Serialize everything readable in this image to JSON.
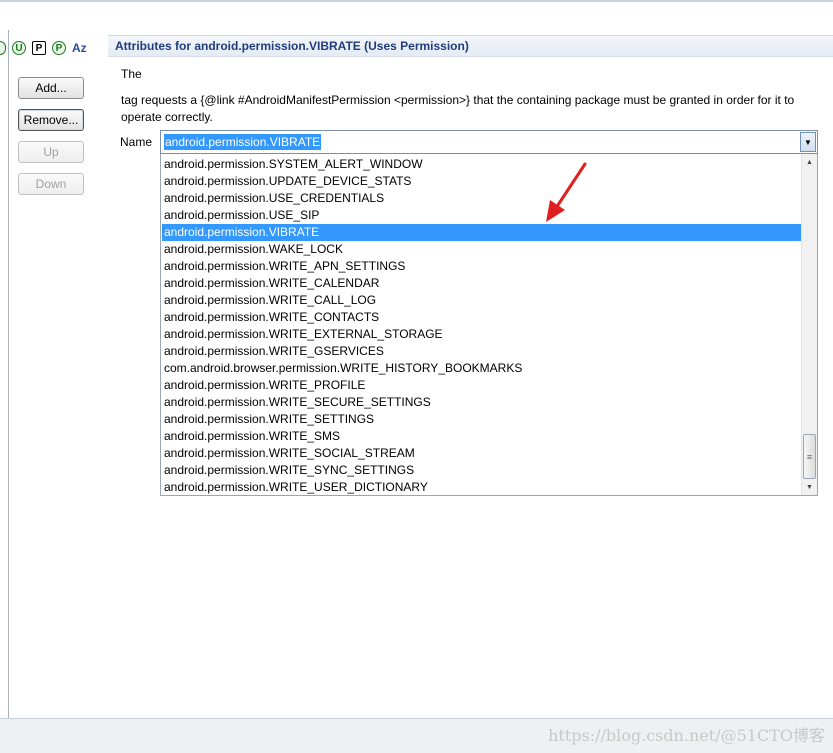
{
  "left_toolbar": {
    "icons": [
      {
        "name": "uses-sdk-icon",
        "glyph": ""
      },
      {
        "name": "uses-permission-icon",
        "glyph": "U"
      },
      {
        "name": "permission-icon",
        "glyph": "P"
      },
      {
        "name": "permission-tree-icon",
        "glyph": "P"
      },
      {
        "name": "sort-az-icon",
        "glyph": "Az"
      }
    ]
  },
  "buttons": {
    "add": "Add...",
    "remove": "Remove...",
    "up": "Up",
    "down": "Down"
  },
  "attributes": {
    "header": "Attributes for android.permission.VIBRATE (Uses Permission)",
    "desc_word": "The",
    "description": "tag requests a {@link #AndroidManifestPermission <permission>} that the containing package must be granted in order for it to operate correctly.",
    "name_label": "Name",
    "name_value": "android.permission.VIBRATE"
  },
  "dropdown": {
    "items": [
      "android.permission.SYSTEM_ALERT_WINDOW",
      "android.permission.UPDATE_DEVICE_STATS",
      "android.permission.USE_CREDENTIALS",
      "android.permission.USE_SIP",
      "android.permission.VIBRATE",
      "android.permission.WAKE_LOCK",
      "android.permission.WRITE_APN_SETTINGS",
      "android.permission.WRITE_CALENDAR",
      "android.permission.WRITE_CALL_LOG",
      "android.permission.WRITE_CONTACTS",
      "android.permission.WRITE_EXTERNAL_STORAGE",
      "android.permission.WRITE_GSERVICES",
      "com.android.browser.permission.WRITE_HISTORY_BOOKMARKS",
      "android.permission.WRITE_PROFILE",
      "android.permission.WRITE_SECURE_SETTINGS",
      "android.permission.WRITE_SETTINGS",
      "android.permission.WRITE_SMS",
      "android.permission.WRITE_SOCIAL_STREAM",
      "android.permission.WRITE_SYNC_SETTINGS",
      "android.permission.WRITE_USER_DICTIONARY"
    ],
    "selected_index": 4
  },
  "colors": {
    "selection": "#3399ff",
    "header_text": "#1f3d7a",
    "annotation_arrow": "#e02020"
  },
  "watermark": "https://blog.csdn.net/@51CTO博客"
}
